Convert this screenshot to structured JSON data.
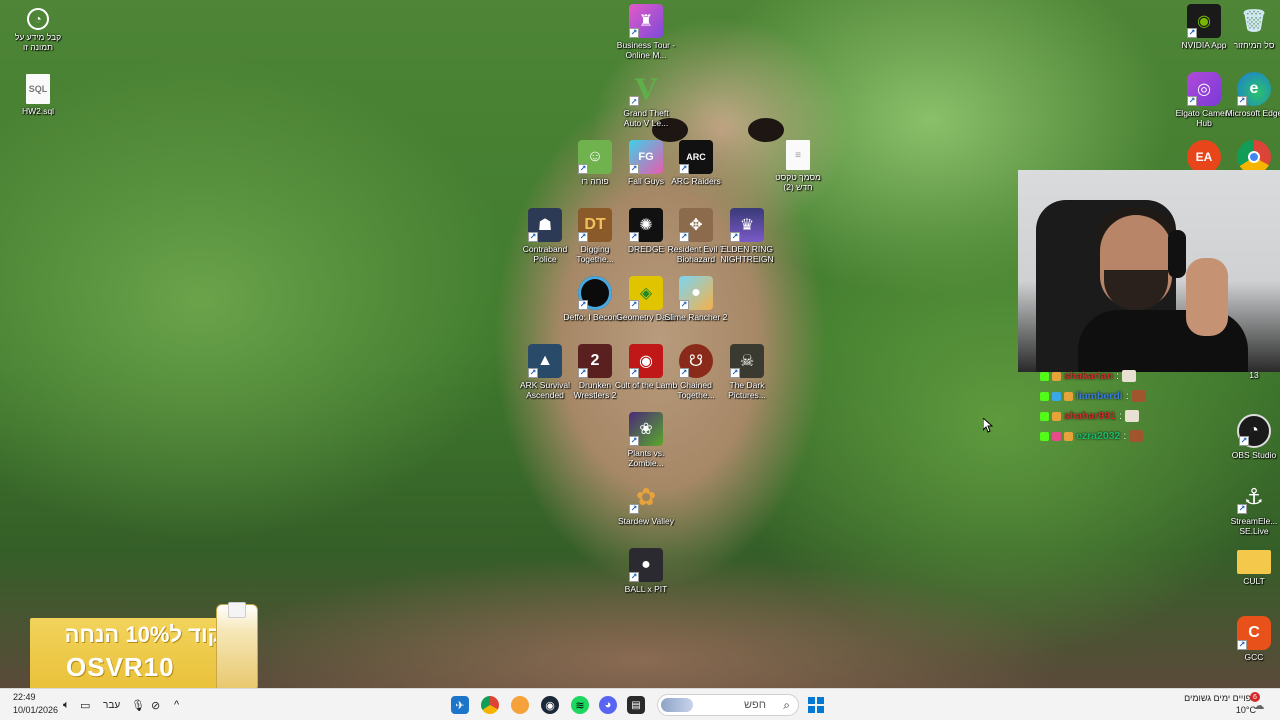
{
  "desktop": {
    "left_icons": [
      {
        "label": "קבל מידע על תמונה זו",
        "icon": "info-icon"
      },
      {
        "label": "HW2.sql",
        "icon": "file-icon"
      }
    ],
    "center_icons": [
      {
        "label": "Business Tour - Online M...",
        "icon": "business-tour-icon"
      },
      {
        "label": "Grand Theft Auto V Le...",
        "icon": "gta-icon"
      },
      {
        "label": "פוחה רו",
        "icon": "game-icon"
      },
      {
        "label": "Fall Guys",
        "icon": "fall-guys-icon"
      },
      {
        "label": "ARC Raiders",
        "icon": "arc-raiders-icon"
      },
      {
        "label": "מסמך טקסט חדש (2)",
        "icon": "text-file-icon"
      },
      {
        "label": "Contraband Police",
        "icon": "contraband-icon"
      },
      {
        "label": "Digging Togethe...",
        "icon": "digging-icon"
      },
      {
        "label": "DREDGE",
        "icon": "dredge-icon"
      },
      {
        "label": "Resident Evil 7 Biohazard",
        "icon": "re7-icon"
      },
      {
        "label": "ELDEN RING NIGHTREIGN",
        "icon": "elden-ring-icon"
      },
      {
        "label": "Deffo: I Becom...",
        "icon": "deffo-icon"
      },
      {
        "label": "Geometry Dash",
        "icon": "geometry-dash-icon"
      },
      {
        "label": "Slime Rancher 2",
        "icon": "slime-rancher-icon"
      },
      {
        "label": "ARK Survival Ascended",
        "icon": "ark-icon"
      },
      {
        "label": "Drunken Wrestlers 2",
        "icon": "drunken-wrestlers-icon"
      },
      {
        "label": "Cult of the Lamb",
        "icon": "cult-lamb-icon"
      },
      {
        "label": "Chained Togethe...",
        "icon": "chained-icon"
      },
      {
        "label": "The Dark Pictures...",
        "icon": "dark-pictures-icon"
      },
      {
        "label": "Plants vs. Zombie...",
        "icon": "pvz-icon"
      },
      {
        "label": "Stardew Valley",
        "icon": "stardew-icon"
      },
      {
        "label": "BALL x PIT",
        "icon": "ball-pit-icon"
      }
    ],
    "right_icons": [
      {
        "label": "NVIDIA App",
        "icon": "nvidia-icon"
      },
      {
        "label": "סל המיחזור",
        "icon": "recycle-bin-icon"
      },
      {
        "label": "Elgato Camera Hub",
        "icon": "elgato-icon"
      },
      {
        "label": "Microsoft Edge",
        "icon": "edge-icon"
      },
      {
        "label": "",
        "icon": "ea-icon"
      },
      {
        "label": "",
        "icon": "chrome-icon"
      },
      {
        "label": "Driver Booster 13",
        "icon": "driver-booster-icon"
      },
      {
        "label": "OBS Studio",
        "icon": "obs-icon"
      },
      {
        "label": "StreamEle... SE.Live",
        "icon": "streamelements-icon"
      },
      {
        "label": "CULT",
        "icon": "folder-icon"
      },
      {
        "label": "GCC",
        "icon": "gcc-icon"
      }
    ]
  },
  "chat": [
    {
      "name": "shakarian",
      "sep": ":",
      "color": "#d62a2a"
    },
    {
      "name": "liamberdi",
      "sep": ":",
      "color": "#3a7bd5"
    },
    {
      "name": "shahar991",
      "sep": ":",
      "color": "#d62a2a"
    },
    {
      "name": "ezra2032",
      "sep": ":",
      "color": "#1fb86a"
    }
  ],
  "promo": {
    "line1": "קוד ל10% הנחה",
    "code": "OSVR10"
  },
  "taskbar": {
    "time": "22:49",
    "date": "10/01/2026",
    "lang": "עבר",
    "search_placeholder": "חפש",
    "weather_text": "צפויים ימים גשומים",
    "weather_temp": "10°C",
    "notification_count": "6"
  },
  "colors": {
    "taskbar_bg": "#f3f3f3",
    "promo_bg": "#e9c13a",
    "accent": "#0078d4"
  }
}
